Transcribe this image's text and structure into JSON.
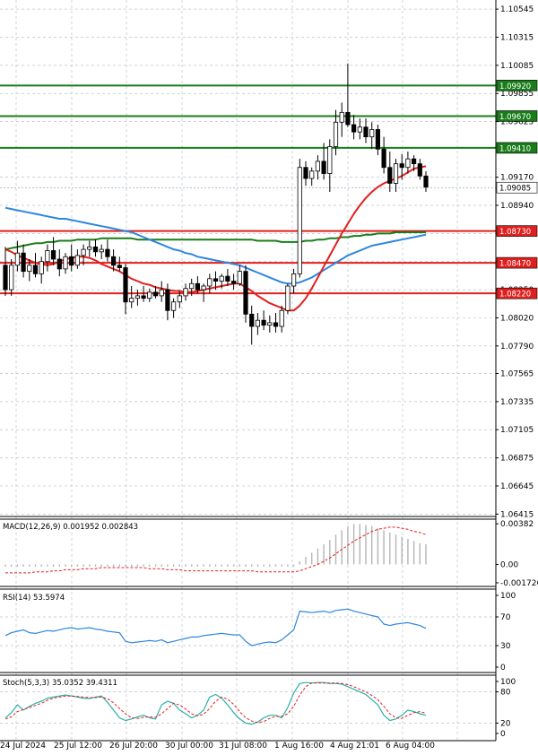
{
  "chart_data": {
    "type": "candlestick",
    "y_ticks": [
      "1.10545",
      "1.10315",
      "1.10085",
      "1.09855",
      "1.09625",
      "1.09170",
      "1.08940",
      "1.08710",
      "1.08480",
      "1.08250",
      "1.08020",
      "1.07790",
      "1.07565",
      "1.07335",
      "1.07105",
      "1.06875",
      "1.06645",
      "1.06415"
    ],
    "ylim": [
      1.0641,
      1.1059
    ],
    "x_ticks": [
      "24 Jul 2024",
      "25 Jul 12:00",
      "26 Jul 20:00",
      "30 Jul 00:00",
      "31 Jul 08:00",
      "1 Aug 16:00",
      "4 Aug 21:01",
      "6 Aug 04:00"
    ],
    "current_price": "1.09085",
    "green_levels": [
      {
        "value": 1.0992,
        "label": "1.09920"
      },
      {
        "value": 1.0967,
        "label": "1.09670"
      },
      {
        "value": 1.0941,
        "label": "1.09410"
      }
    ],
    "red_levels": [
      {
        "value": 1.0873,
        "label": "1.08730"
      },
      {
        "value": 1.0847,
        "label": "1.08470"
      },
      {
        "value": 1.0822,
        "label": "1.08220"
      }
    ],
    "candles": [
      [
        1.0845,
        1.086,
        1.082,
        1.0825
      ],
      [
        1.0825,
        1.085,
        1.082,
        1.0845
      ],
      [
        1.0845,
        1.0865,
        1.084,
        1.0855
      ],
      [
        1.0855,
        1.0862,
        1.0835,
        1.084
      ],
      [
        1.084,
        1.085,
        1.0832,
        1.0845
      ],
      [
        1.0845,
        1.0855,
        1.0835,
        1.0838
      ],
      [
        1.0838,
        1.0852,
        1.083,
        1.0848
      ],
      [
        1.0848,
        1.0862,
        1.084,
        1.0857
      ],
      [
        1.0857,
        1.0868,
        1.0845,
        1.085
      ],
      [
        1.085,
        1.0858,
        1.0836,
        1.0842
      ],
      [
        1.0842,
        1.0855,
        1.0838,
        1.0852
      ],
      [
        1.0852,
        1.0862,
        1.084,
        1.0845
      ],
      [
        1.0845,
        1.0858,
        1.0842,
        1.0853
      ],
      [
        1.0853,
        1.0862,
        1.0845,
        1.0858
      ],
      [
        1.0858,
        1.0865,
        1.0852,
        1.086
      ],
      [
        1.086,
        1.0866,
        1.0852,
        1.0856
      ],
      [
        1.0856,
        1.0862,
        1.085,
        1.0858
      ],
      [
        1.0858,
        1.0866,
        1.0848,
        1.0852
      ],
      [
        1.0852,
        1.0858,
        1.084,
        1.0845
      ],
      [
        1.0845,
        1.0852,
        1.084,
        1.0843
      ],
      [
        1.0843,
        1.0846,
        1.0805,
        1.0815
      ],
      [
        1.0815,
        1.0828,
        1.081,
        1.0818
      ],
      [
        1.0818,
        1.0825,
        1.0812,
        1.082
      ],
      [
        1.082,
        1.0828,
        1.0815,
        1.0818
      ],
      [
        1.0818,
        1.0826,
        1.0815,
        1.0823
      ],
      [
        1.0823,
        1.0828,
        1.0818,
        1.082
      ],
      [
        1.082,
        1.0832,
        1.0815,
        1.0825
      ],
      [
        1.0825,
        1.083,
        1.08,
        1.0808
      ],
      [
        1.0808,
        1.0818,
        1.0802,
        1.0815
      ],
      [
        1.0815,
        1.0824,
        1.081,
        1.082
      ],
      [
        1.082,
        1.083,
        1.0816,
        1.0826
      ],
      [
        1.0826,
        1.0834,
        1.082,
        1.083
      ],
      [
        1.083,
        1.0836,
        1.0822,
        1.0825
      ],
      [
        1.0825,
        1.083,
        1.0815,
        1.0828
      ],
      [
        1.0828,
        1.0838,
        1.0822,
        1.0834
      ],
      [
        1.0834,
        1.084,
        1.0825,
        1.0832
      ],
      [
        1.0832,
        1.0838,
        1.0826,
        1.0836
      ],
      [
        1.0836,
        1.0842,
        1.0828,
        1.0832
      ],
      [
        1.0832,
        1.0838,
        1.0825,
        1.083
      ],
      [
        1.083,
        1.0845,
        1.0828,
        1.084
      ],
      [
        1.084,
        1.0845,
        1.0798,
        1.0805
      ],
      [
        1.0805,
        1.0812,
        1.078,
        1.0795
      ],
      [
        1.0795,
        1.0806,
        1.0788,
        1.08
      ],
      [
        1.08,
        1.0808,
        1.0792,
        1.0796
      ],
      [
        1.0796,
        1.0804,
        1.079,
        1.0798
      ],
      [
        1.0798,
        1.0806,
        1.079,
        1.0795
      ],
      [
        1.0795,
        1.0812,
        1.079,
        1.0808
      ],
      [
        1.0808,
        1.083,
        1.0805,
        1.0828
      ],
      [
        1.0828,
        1.0842,
        1.0822,
        1.0838
      ],
      [
        1.0838,
        1.0932,
        1.0835,
        1.0925
      ],
      [
        1.0925,
        1.093,
        1.091,
        1.0916
      ],
      [
        1.0916,
        1.0925,
        1.091,
        1.0922
      ],
      [
        1.0922,
        1.0935,
        1.0915,
        1.093
      ],
      [
        1.093,
        1.0945,
        1.0915,
        1.092
      ],
      [
        1.092,
        1.0948,
        1.0905,
        1.0942
      ],
      [
        1.0942,
        1.0972,
        1.0935,
        1.0962
      ],
      [
        1.0962,
        1.0978,
        1.095,
        1.097
      ],
      [
        1.097,
        1.101,
        1.0958,
        1.096
      ],
      [
        1.096,
        1.0968,
        1.0948,
        1.0954
      ],
      [
        1.0954,
        1.0965,
        1.0948,
        1.0958
      ],
      [
        1.0958,
        1.0965,
        1.0945,
        1.095
      ],
      [
        1.095,
        1.0962,
        1.094,
        1.0956
      ],
      [
        1.0956,
        1.096,
        1.0935,
        1.094
      ],
      [
        1.094,
        1.095,
        1.092,
        1.0925
      ],
      [
        1.0925,
        1.0938,
        1.0905,
        1.0912
      ],
      [
        1.0912,
        1.0932,
        1.0905,
        1.0928
      ],
      [
        1.0928,
        1.0936,
        1.0915,
        1.0925
      ],
      [
        1.0925,
        1.0938,
        1.092,
        1.0932
      ],
      [
        1.0932,
        1.0935,
        1.0922,
        1.0928
      ],
      [
        1.0928,
        1.0932,
        1.0915,
        1.0918
      ],
      [
        1.0918,
        1.0922,
        1.0905,
        1.0909
      ]
    ],
    "ma_red": [
      1.0858,
      1.0856,
      1.0853,
      1.0851,
      1.0849,
      1.0847,
      1.0846,
      1.0845,
      1.0846,
      1.0848,
      1.085,
      1.0851,
      1.0852,
      1.0852,
      1.0851,
      1.0849,
      1.0846,
      1.0844,
      1.0842,
      1.084,
      1.0837,
      1.0834,
      1.0832,
      1.083,
      1.0829,
      1.0827,
      1.0826,
      1.0825,
      1.0824,
      1.0824,
      1.0823,
      1.0823,
      1.0824,
      1.0825,
      1.0826,
      1.0827,
      1.0828,
      1.0829,
      1.083,
      1.083,
      1.0827,
      1.0824,
      1.082,
      1.0817,
      1.0814,
      1.0812,
      1.081,
      1.0808,
      1.0808,
      1.0812,
      1.0818,
      1.0826,
      1.0835,
      1.0844,
      1.0853,
      1.0862,
      1.0871,
      1.0879,
      1.0887,
      1.0894,
      1.09,
      1.0905,
      1.0909,
      1.0912,
      1.0914,
      1.0916,
      1.0918,
      1.0921,
      1.0924,
      1.0925,
      1.0926
    ],
    "ma_blue": [
      1.0892,
      1.0891,
      1.089,
      1.0889,
      1.0888,
      1.0887,
      1.0886,
      1.0885,
      1.0884,
      1.0883,
      1.0883,
      1.0882,
      1.0881,
      1.088,
      1.0879,
      1.0878,
      1.0877,
      1.0876,
      1.0875,
      1.0874,
      1.0873,
      1.0872,
      1.087,
      1.0868,
      1.0866,
      1.0864,
      1.0862,
      1.086,
      1.0858,
      1.0857,
      1.0855,
      1.0854,
      1.0852,
      1.0851,
      1.085,
      1.0849,
      1.0848,
      1.0847,
      1.0846,
      1.0845,
      1.0843,
      1.0841,
      1.0839,
      1.0837,
      1.0835,
      1.0833,
      1.0831,
      1.083,
      1.083,
      1.0831,
      1.0833,
      1.0835,
      1.0838,
      1.0841,
      1.0844,
      1.0847,
      1.085,
      1.0853,
      1.0855,
      1.0857,
      1.0859,
      1.0861,
      1.0862,
      1.0863,
      1.0864,
      1.0865,
      1.0866,
      1.0867,
      1.0868,
      1.0869,
      1.087
    ],
    "ma_green": [
      1.0858,
      1.0859,
      1.086,
      1.0861,
      1.0862,
      1.0863,
      1.0863,
      1.0864,
      1.0864,
      1.0865,
      1.0865,
      1.0865,
      1.0866,
      1.0866,
      1.0866,
      1.0866,
      1.0867,
      1.0867,
      1.0867,
      1.0867,
      1.0867,
      1.0867,
      1.0866,
      1.0866,
      1.0866,
      1.0866,
      1.0866,
      1.0866,
      1.0866,
      1.0866,
      1.0866,
      1.0866,
      1.0866,
      1.0866,
      1.0866,
      1.0866,
      1.0866,
      1.0866,
      1.0866,
      1.0866,
      1.0866,
      1.0866,
      1.0865,
      1.0865,
      1.0865,
      1.0865,
      1.0864,
      1.0864,
      1.0864,
      1.0864,
      1.0865,
      1.0865,
      1.0866,
      1.0866,
      1.0867,
      1.0867,
      1.0868,
      1.0868,
      1.0869,
      1.0869,
      1.087,
      1.087,
      1.0871,
      1.0871,
      1.0871,
      1.0872,
      1.0872,
      1.0872,
      1.0872,
      1.0872,
      1.0872
    ],
    "macd": {
      "label": "MACD(12,26,9) 0.001952 0.002843",
      "y_ticks": [
        "0.00382",
        "0.00",
        "-0.001726"
      ],
      "ylim": [
        -0.0019,
        0.004
      ],
      "hist": [
        -0.0002,
        -0.0002,
        -0.0002,
        -0.0002,
        -0.0002,
        -0.0002,
        -0.0002,
        -0.0002,
        -0.0002,
        -0.0002,
        -0.0002,
        -0.0002,
        -0.0002,
        -0.0002,
        -0.0002,
        -0.0002,
        -0.0002,
        -0.0002,
        -0.0002,
        -0.0002,
        -0.0002,
        -0.0002,
        -0.0002,
        -0.0002,
        -0.0002,
        -0.0002,
        -0.0002,
        -0.0002,
        -0.0002,
        -0.0002,
        -0.0002,
        -0.0002,
        -0.0002,
        -0.0002,
        -0.0002,
        -0.0002,
        -0.0002,
        -0.0002,
        -0.0002,
        -0.0002,
        -0.0002,
        -0.0002,
        -0.0002,
        -0.0002,
        -0.0002,
        -0.0002,
        -0.0002,
        -0.0002,
        -0.0002,
        0.0003,
        0.0007,
        0.0011,
        0.0015,
        0.0019,
        0.0023,
        0.0028,
        0.0032,
        0.0036,
        0.0038,
        0.0038,
        0.0037,
        0.0036,
        0.0034,
        0.0032,
        0.003,
        0.0028,
        0.0026,
        0.0024,
        0.0022,
        0.002,
        0.0019
      ],
      "signal": [
        -0.0008,
        -0.0008,
        -0.0008,
        -0.0008,
        -0.0008,
        -0.0007,
        -0.0007,
        -0.0007,
        -0.0006,
        -0.0006,
        -0.0005,
        -0.0005,
        -0.0005,
        -0.0004,
        -0.0004,
        -0.0004,
        -0.0003,
        -0.0003,
        -0.0003,
        -0.0003,
        -0.0003,
        -0.0003,
        -0.0003,
        -0.0003,
        -0.0004,
        -0.0004,
        -0.0004,
        -0.0005,
        -0.0005,
        -0.0005,
        -0.0006,
        -0.0006,
        -0.0006,
        -0.0006,
        -0.0006,
        -0.0006,
        -0.0006,
        -0.0006,
        -0.0006,
        -0.0006,
        -0.0006,
        -0.0006,
        -0.0007,
        -0.0007,
        -0.0007,
        -0.0007,
        -0.0007,
        -0.0007,
        -0.0007,
        -0.0006,
        -0.0004,
        -0.0002,
        0.0,
        0.0003,
        0.0006,
        0.001,
        0.0014,
        0.0018,
        0.0022,
        0.0025,
        0.0028,
        0.0031,
        0.0033,
        0.0034,
        0.0035,
        0.0035,
        0.0034,
        0.0033,
        0.0031,
        0.003,
        0.0028
      ]
    },
    "rsi": {
      "label": "RSI(14) 53.5974",
      "y_ticks": [
        "100",
        "70",
        "30",
        "0"
      ],
      "ylim": [
        0,
        100
      ],
      "values": [
        44,
        48,
        50,
        52,
        48,
        47,
        49,
        51,
        50,
        52,
        54,
        55,
        53,
        54,
        55,
        53,
        52,
        50,
        49,
        48,
        36,
        34,
        35,
        36,
        37,
        36,
        38,
        34,
        36,
        38,
        40,
        42,
        42,
        44,
        45,
        46,
        47,
        46,
        45,
        45,
        36,
        30,
        32,
        34,
        35,
        34,
        38,
        45,
        52,
        78,
        77,
        76,
        77,
        78,
        76,
        79,
        80,
        81,
        78,
        76,
        74,
        72,
        70,
        60,
        58,
        60,
        61,
        62,
        60,
        58,
        54
      ]
    },
    "stoch": {
      "label": "Stoch(5,3,3) 35.0352 39.4311",
      "y_ticks": [
        "100",
        "80",
        "20",
        "0"
      ],
      "ylim": [
        0,
        100
      ],
      "k": [
        30,
        40,
        55,
        45,
        52,
        58,
        62,
        68,
        70,
        72,
        74,
        72,
        70,
        68,
        67,
        70,
        72,
        60,
        45,
        30,
        25,
        28,
        32,
        35,
        30,
        28,
        55,
        62,
        58,
        45,
        38,
        30,
        35,
        45,
        70,
        75,
        68,
        55,
        40,
        28,
        20,
        18,
        22,
        30,
        35,
        35,
        30,
        50,
        78,
        96,
        98,
        97,
        98,
        98,
        96,
        96,
        95,
        90,
        85,
        80,
        75,
        65,
        55,
        35,
        25,
        28,
        35,
        45,
        42,
        38,
        35
      ],
      "d": [
        28,
        32,
        42,
        46,
        50,
        54,
        58,
        64,
        68,
        70,
        72,
        72,
        71,
        70,
        69,
        69,
        70,
        67,
        59,
        48,
        38,
        30,
        29,
        31,
        32,
        31,
        38,
        48,
        58,
        55,
        47,
        38,
        34,
        37,
        48,
        62,
        70,
        66,
        56,
        42,
        30,
        24,
        21,
        23,
        29,
        33,
        33,
        38,
        52,
        74,
        90,
        97,
        97,
        97,
        97,
        97,
        96,
        94,
        90,
        85,
        80,
        73,
        65,
        52,
        38,
        30,
        29,
        35,
        40,
        42,
        39
      ]
    }
  }
}
